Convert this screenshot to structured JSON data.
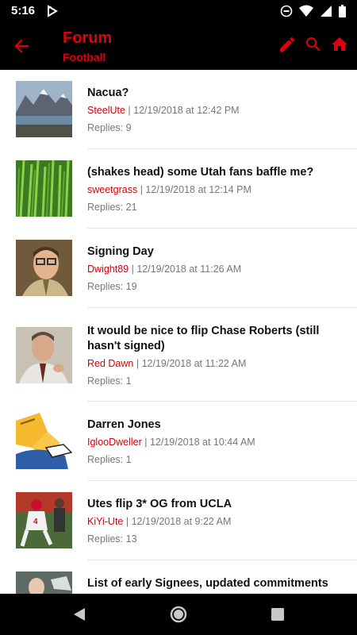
{
  "status_bar": {
    "time": "5:16"
  },
  "app_bar": {
    "title": "Forum",
    "subtitle": "Football"
  },
  "colors": {
    "accent": "#e0000b",
    "author": "#d4000a",
    "meta": "#777777"
  },
  "threads": [
    {
      "title": "Nacua?",
      "author": "SteelUte",
      "date": " | 12/19/2018 at 12:42 PM",
      "replies": "Replies: 9",
      "thumb": "mountain-lake"
    },
    {
      "title": "(shakes head) some Utah fans baffle me?",
      "author": "sweetgrass",
      "date": " | 12/19/2018 at 12:14 PM",
      "replies": "Replies: 21",
      "thumb": "grass"
    },
    {
      "title": "Signing Day",
      "author": "Dwight89",
      "date": " | 12/19/2018 at 11:26 AM",
      "replies": "Replies: 19",
      "thumb": "man-glasses"
    },
    {
      "title": "It would be nice to flip Chase Roberts (still hasn't signed)",
      "author": "Red Dawn",
      "date": " | 12/19/2018 at 11:22 AM",
      "replies": "Replies: 1",
      "thumb": "man-office"
    },
    {
      "title": "Darren Jones",
      "author": "IglooDweller",
      "date": " | 12/19/2018 at 10:44 AM",
      "replies": "Replies: 1",
      "thumb": "cartoon"
    },
    {
      "title": "Utes flip 3* OG from UCLA",
      "author": "KiYi-Ute",
      "date": " | 12/19/2018 at 9:22 AM",
      "replies": "Replies: 13",
      "thumb": "football-players"
    },
    {
      "title": "List of early Signees, updated commitments",
      "author": "",
      "date": "",
      "replies": "",
      "thumb": "partial"
    }
  ]
}
